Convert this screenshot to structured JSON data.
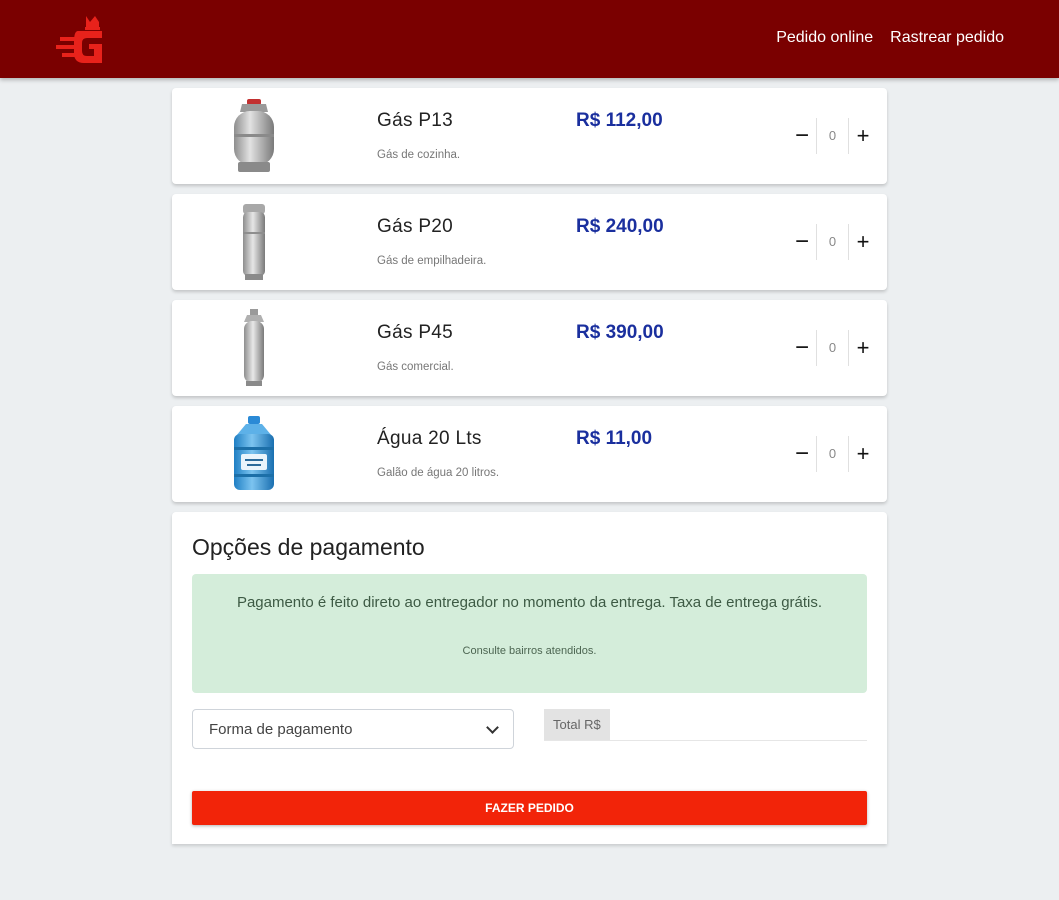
{
  "nav": {
    "links": [
      "Pedido online",
      "Rastrear pedido"
    ]
  },
  "products": [
    {
      "name": "Gás P13",
      "desc": "Gás de cozinha.",
      "price": "R$ 112,00",
      "qty": "0"
    },
    {
      "name": "Gás P20",
      "desc": "Gás de empilhadeira.",
      "price": "R$ 240,00",
      "qty": "0"
    },
    {
      "name": "Gás P45",
      "desc": "Gás comercial.",
      "price": "R$ 390,00",
      "qty": "0"
    },
    {
      "name": "Água 20 Lts",
      "desc": "Galão de água 20 litros.",
      "price": "R$ 11,00",
      "qty": "0"
    }
  ],
  "qty_controls": {
    "minus": "−",
    "plus": "+"
  },
  "payment": {
    "title": "Opções de pagamento",
    "alert_main": "Pagamento é feito direto ao entregador no momento da entrega. Taxa de entrega grátis.",
    "alert_sub": "Consulte bairros atendidos.",
    "select_value": "Forma de pagamento",
    "total_label": "Total R$",
    "total_value": "",
    "submit_label": "FAZER PEDIDO"
  },
  "colors": {
    "navbar": "#7a0000",
    "logo": "#e8221b",
    "price": "#1a2f9e",
    "alert_bg": "#d4edda",
    "submit_bg": "#f22409"
  },
  "icons": {
    "logo": "gas-delivery-logo-icon",
    "minus": "minus-icon",
    "plus": "plus-icon",
    "select": "chevron-down-icon"
  }
}
